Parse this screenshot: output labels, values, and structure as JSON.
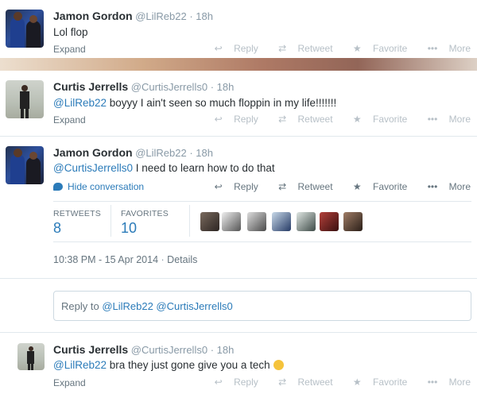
{
  "tweet1": {
    "fullname": "Jamon Gordon",
    "username": "@LilReb22",
    "separator": "·",
    "time": "18h",
    "text": "Lol flop",
    "expand": "Expand",
    "actions": {
      "reply": "Reply",
      "retweet": "Retweet",
      "favorite": "Favorite",
      "more": "More"
    }
  },
  "tweet2": {
    "fullname": "Curtis Jerrells",
    "username": "@CurtisJerrells0",
    "separator": "·",
    "time": "18h",
    "mention": "@LilReb22",
    "text": " boyyy I ain't seen so much floppin in my life!!!!!!!",
    "expand": "Expand",
    "actions": {
      "reply": "Reply",
      "retweet": "Retweet",
      "favorite": "Favorite",
      "more": "More"
    }
  },
  "tweet3": {
    "fullname": "Jamon Gordon",
    "username": "@LilReb22",
    "separator": "·",
    "time": "18h",
    "mention": "@CurtisJerrells0",
    "text": " I need to learn how to do that",
    "hide_conversation": "Hide conversation",
    "actions": {
      "reply": "Reply",
      "retweet": "Retweet",
      "favorite": "Favorite",
      "more": "More"
    },
    "stats": {
      "retweets_label": "RETWEETS",
      "retweets_value": "8",
      "favorites_label": "FAVORITES",
      "favorites_value": "10"
    },
    "timestamp": "10:38 PM - 15 Apr 2014",
    "details": "Details"
  },
  "reply_box": {
    "prefix": "Reply to ",
    "mentions": "@LilReb22 @CurtisJerrells0"
  },
  "tweet4": {
    "fullname": "Curtis Jerrells",
    "username": "@CurtisJerrells0",
    "separator": "·",
    "time": "18h",
    "mention": "@LilReb22",
    "text": " bra they just gone give you a tech",
    "expand": "Expand",
    "actions": {
      "reply": "Reply",
      "retweet": "Retweet",
      "favorite": "Favorite",
      "more": "More"
    }
  },
  "colors": {
    "link": "#2b7bb9",
    "muted": "#8899a6",
    "text": "#292f33"
  }
}
